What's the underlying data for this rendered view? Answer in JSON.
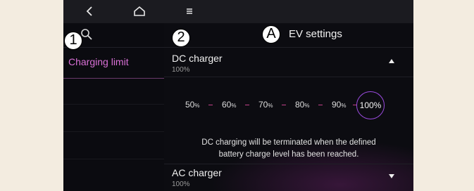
{
  "icons": {
    "back": "back-arrow-icon",
    "home": "home-icon",
    "menu": "menu-icon",
    "search": "search-icon",
    "expand_up": "chevron-up-icon",
    "expand_down": "chevron-down-icon"
  },
  "sidebar": {
    "items": [
      {
        "label": "Charging limit",
        "active": true
      }
    ]
  },
  "main": {
    "title": "EV settings",
    "dc": {
      "title": "DC charger",
      "value": "100%",
      "levels": [
        {
          "num": "50",
          "unit": "%"
        },
        {
          "num": "60",
          "unit": "%"
        },
        {
          "num": "70",
          "unit": "%"
        },
        {
          "num": "80",
          "unit": "%"
        },
        {
          "num": "90",
          "unit": "%"
        }
      ],
      "selected": "100%",
      "description_line1": "DC charging will be terminated when the defined",
      "description_line2": "battery charge level has been reached."
    },
    "ac": {
      "title": "AC charger",
      "value": "100%"
    }
  },
  "callouts": {
    "one": "1",
    "two": "2",
    "a": "A"
  },
  "colors": {
    "accent_pink": "#d970d6",
    "selected_ring": "#9b4be0",
    "dash": "#c2418a",
    "background": "#0c0c11"
  }
}
